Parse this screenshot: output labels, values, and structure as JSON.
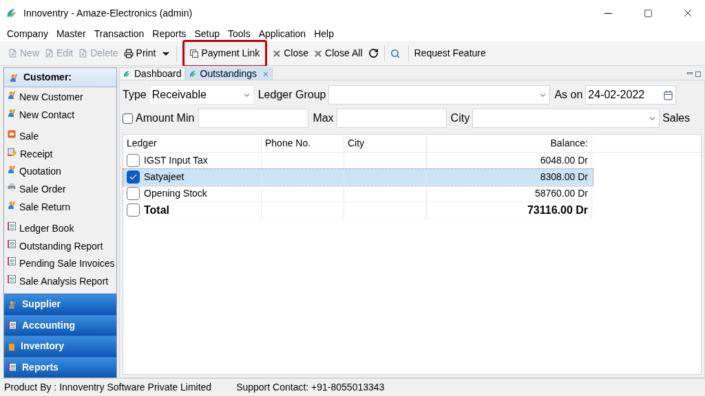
{
  "window": {
    "title": "Innoventry - Amaze-Electronics (admin)"
  },
  "menu": [
    "Company",
    "Master",
    "Transaction",
    "Reports",
    "Setup",
    "Tools",
    "Application",
    "Help"
  ],
  "toolbar": [
    {
      "kind": "new",
      "label": "New",
      "disabled": true,
      "highlighted": false
    },
    {
      "kind": "edit",
      "label": "Edit",
      "disabled": true,
      "highlighted": false
    },
    {
      "kind": "delete",
      "label": "Delete",
      "disabled": true,
      "highlighted": false
    },
    {
      "kind": "print",
      "label": "Print",
      "disabled": false,
      "highlighted": false
    },
    {
      "kind": "link",
      "label": "Payment Link",
      "disabled": false,
      "highlighted": true
    },
    {
      "kind": "close",
      "label": "Close",
      "disabled": false,
      "highlighted": false
    },
    {
      "kind": "close",
      "label": "Close All",
      "disabled": false,
      "highlighted": false
    },
    {
      "kind": "refresh",
      "disabled": false
    },
    {
      "kind": "search",
      "disabled": false
    },
    {
      "kind": "text",
      "label": "Request Feature",
      "disabled": false,
      "highlighted": false
    }
  ],
  "sidebar": {
    "header": "Customer:",
    "groups": [
      [
        {
          "kind": "user",
          "label": "New Customer"
        },
        {
          "kind": "user",
          "label": "New Contact"
        }
      ],
      [
        {
          "kind": "sale",
          "label": "Sale"
        },
        {
          "kind": "receipt",
          "label": "Receipt"
        },
        {
          "kind": "user",
          "label": "Quotation"
        },
        {
          "kind": "order",
          "label": "Sale Order"
        },
        {
          "kind": "user",
          "label": "Sale Return"
        }
      ],
      [
        {
          "kind": "report",
          "label": "Ledger Book"
        },
        {
          "kind": "report",
          "label": "Outstanding Report"
        },
        {
          "kind": "report",
          "label": "Pending Sale Invoices"
        },
        {
          "kind": "report",
          "label": "Sale Analysis Report"
        }
      ]
    ],
    "sections": [
      {
        "kind": "supplier",
        "label": "Supplier"
      },
      {
        "kind": "report",
        "label": "Accounting"
      },
      {
        "kind": "inventory",
        "label": "Inventory"
      },
      {
        "kind": "report",
        "label": "Reports"
      }
    ]
  },
  "tabs": [
    {
      "label": "Dashboard",
      "selected": false,
      "closable": false
    },
    {
      "label": "Outstandings",
      "selected": true,
      "closable": true
    }
  ],
  "filters": {
    "type_label": "Type",
    "type_value": "Receivable",
    "ledger_group_label": "Ledger Group",
    "as_on_label": "As on",
    "as_on_value": "24-02-2022",
    "amount_checked": false,
    "amount_min_label": "Amount Min",
    "max_label": "Max",
    "city_label": "City",
    "sales_label": "Sales"
  },
  "table": {
    "columns": [
      "Ledger",
      "Phone No.",
      "City",
      "Balance:"
    ],
    "rows": [
      {
        "kind": "row",
        "ledger": "IGST Input Tax",
        "balance": "6048.00 Dr",
        "checked": false,
        "selected": false
      },
      {
        "kind": "row",
        "ledger": "Satyajeet",
        "balance": "8308.00 Dr",
        "checked": true,
        "selected": true
      },
      {
        "kind": "row",
        "ledger": "Opening Stock",
        "balance": "58760.00 Dr",
        "checked": false,
        "selected": false
      },
      {
        "kind": "total",
        "ledger": "Total",
        "balance": "73116.00 Dr",
        "checked": false,
        "selected": false
      }
    ]
  },
  "status_bar": {
    "product": "Product By : Innoventry Software Private Limited",
    "support": "Support Contact: +91-8055013343"
  }
}
